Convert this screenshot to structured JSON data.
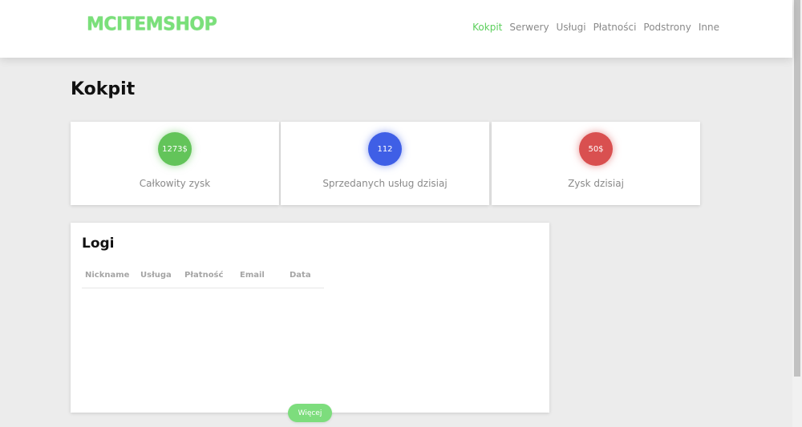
{
  "header": {
    "logo": "MCITEMSHOP",
    "nav": [
      "Kokpit",
      "Serwery",
      "Usługi",
      "Płatności",
      "Podstrony",
      "Inne"
    ],
    "active_nav": "Kokpit"
  },
  "page": {
    "title": "Kokpit"
  },
  "stats": [
    {
      "value": "1273$",
      "label": "Całkowity zysk",
      "color": "#63c45a"
    },
    {
      "value": "112",
      "label": "Sprzedanych usług dzisiaj",
      "color": "#3f5fe6"
    },
    {
      "value": "50$",
      "label": "Zysk dzisiaj",
      "color": "#d95050"
    }
  ],
  "logs": {
    "title": "Logi",
    "columns": [
      "Nickname",
      "Usługa",
      "Płatność",
      "Email",
      "Data"
    ],
    "more_label": "Więcej"
  }
}
